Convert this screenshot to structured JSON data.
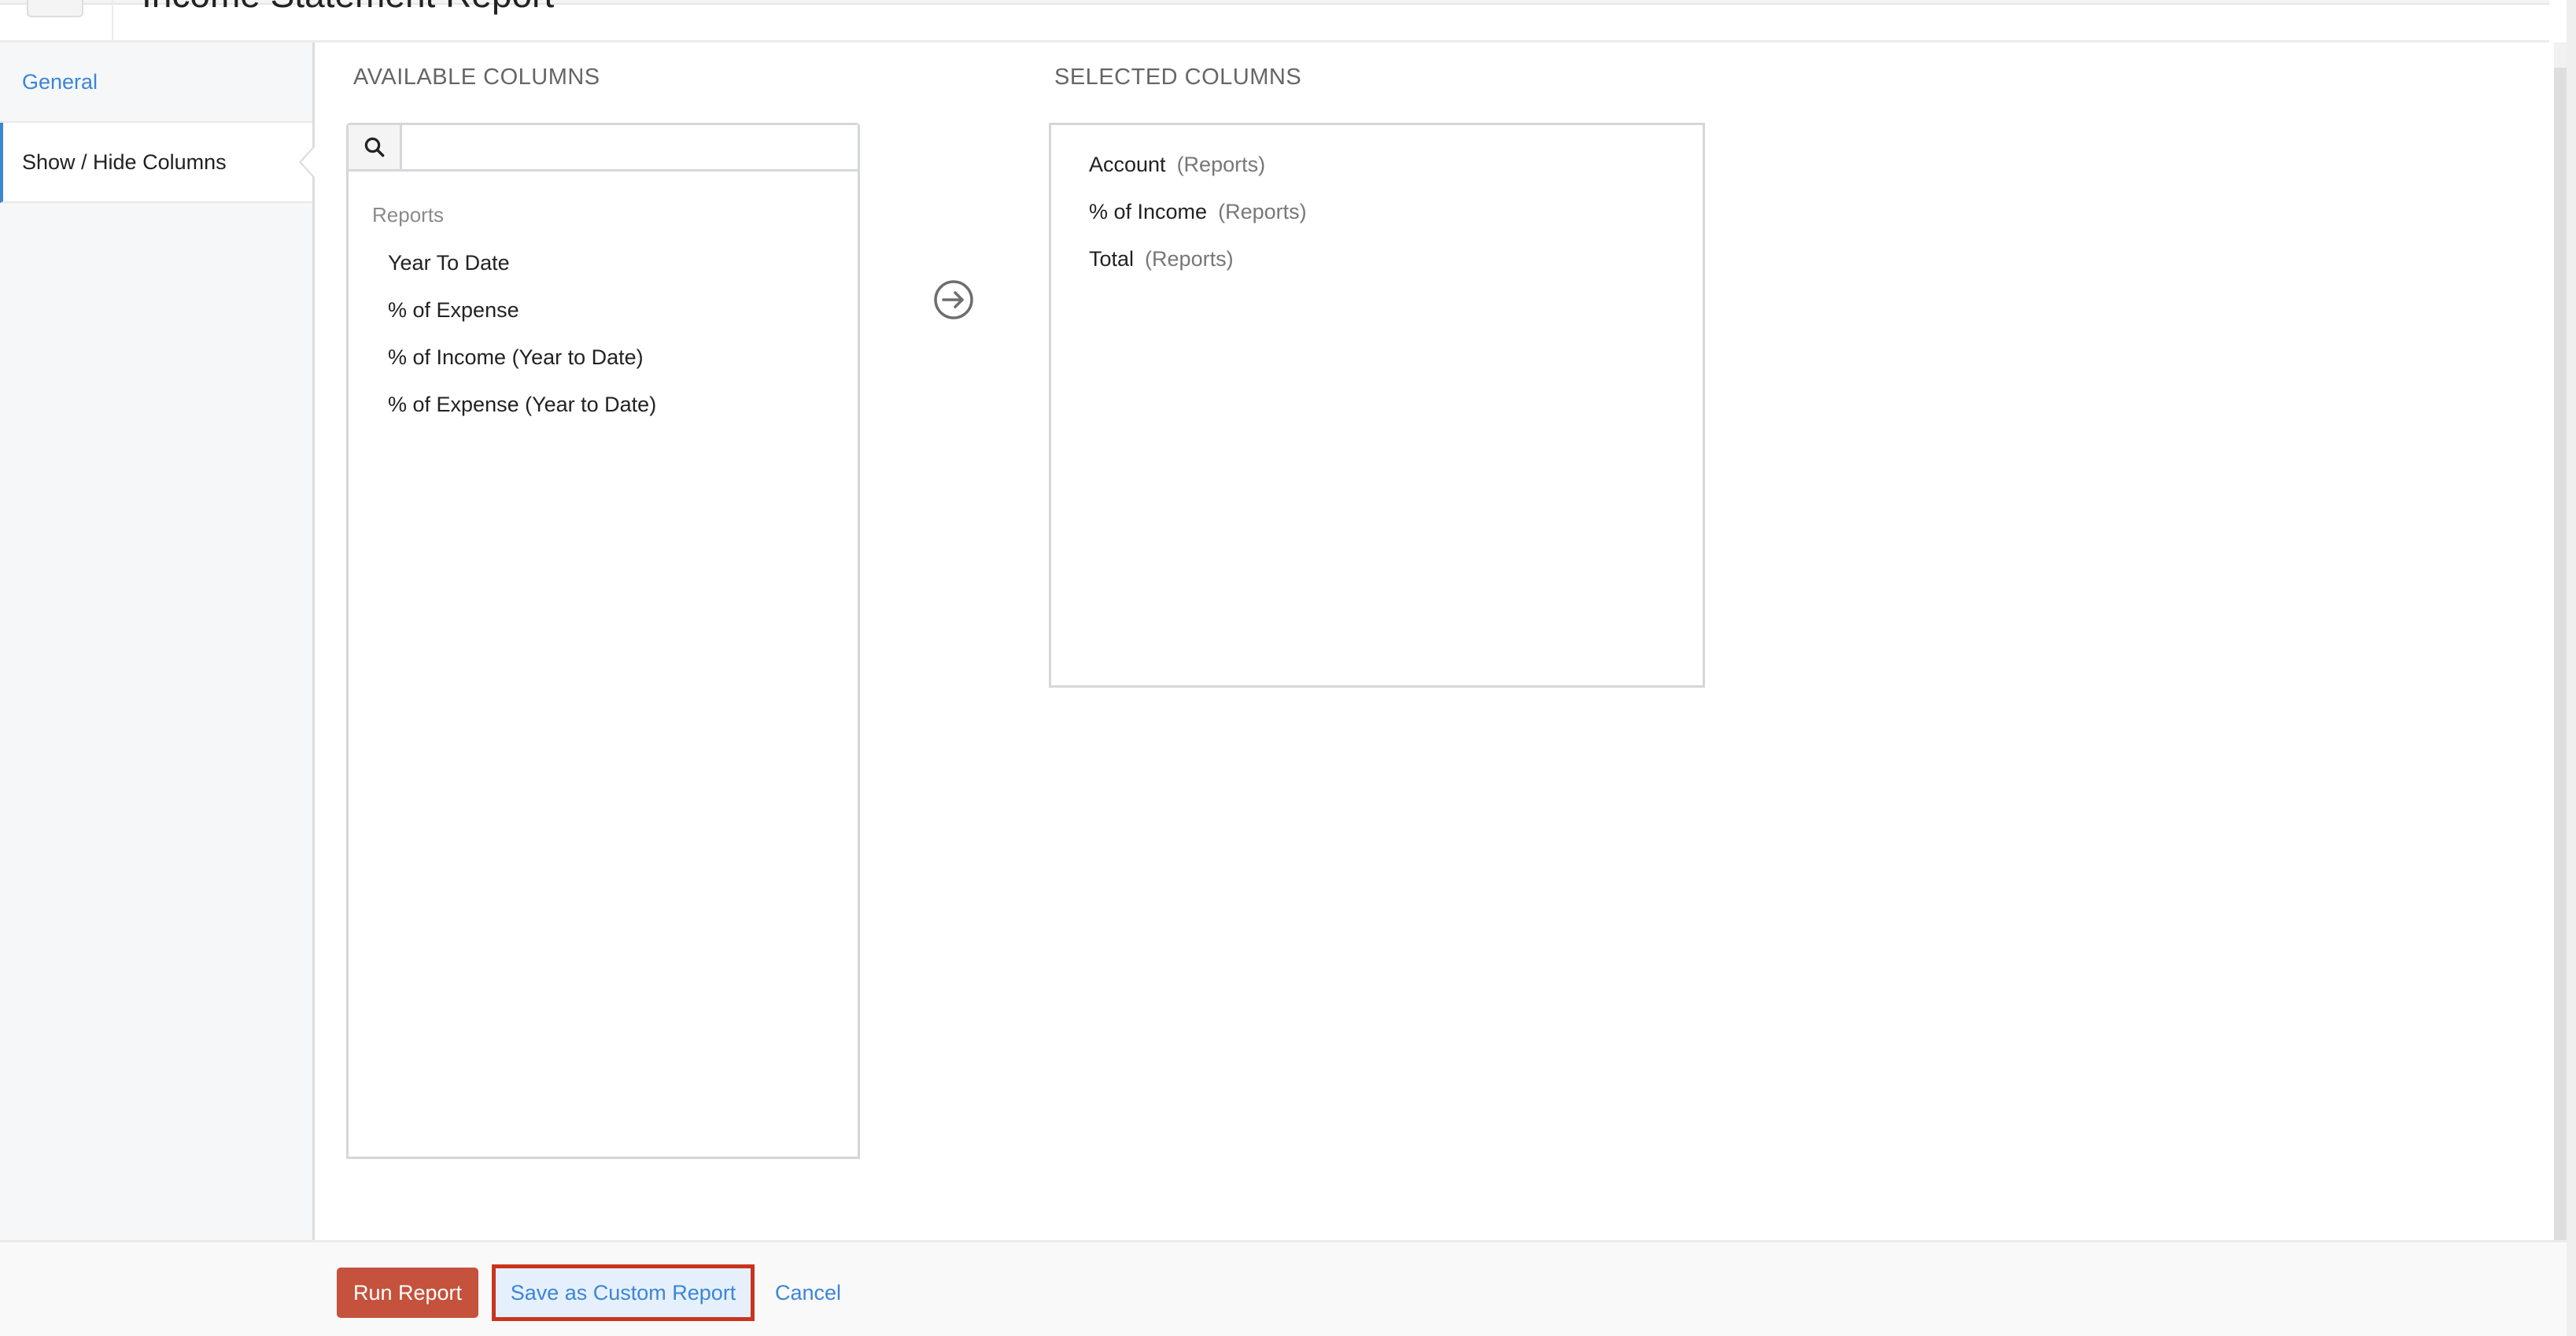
{
  "header": {
    "title": "Income Statement Report"
  },
  "sidebar": {
    "items": [
      {
        "label": "General",
        "active": false
      },
      {
        "label": "Show / Hide Columns",
        "active": true
      }
    ]
  },
  "available": {
    "heading": "AVAILABLE COLUMNS",
    "search": {
      "value": "",
      "placeholder": "",
      "icon": "search-icon"
    },
    "group_label": "Reports",
    "items": [
      "Year To Date",
      "% of Expense",
      "% of Income (Year to Date)",
      "% of Expense (Year to Date)"
    ]
  },
  "move_button": {
    "icon": "arrow-right-circle-icon"
  },
  "selected": {
    "heading": "SELECTED COLUMNS",
    "items": [
      {
        "name": "Account",
        "source": "(Reports)"
      },
      {
        "name": "% of Income",
        "source": "(Reports)"
      },
      {
        "name": "Total",
        "source": "(Reports)"
      }
    ]
  },
  "footer": {
    "run_label": "Run Report",
    "save_label": "Save as Custom Report",
    "cancel_label": "Cancel"
  },
  "colors": {
    "accent": "#3a86d8",
    "primary_button": "#c5523c",
    "highlight_border": "#c9341f",
    "active_tab_bar": "#3b88d0"
  }
}
